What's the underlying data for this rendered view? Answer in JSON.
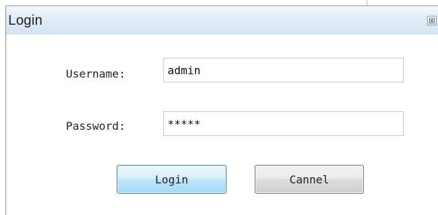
{
  "window": {
    "title": "Login",
    "close_icon": "close-icon"
  },
  "form": {
    "username_label": "Username:",
    "username_value": "admin",
    "password_label": "Password:",
    "password_value": "*****"
  },
  "buttons": {
    "login_label": "Login",
    "cancel_label": "Cannel"
  },
  "colors": {
    "titlebar": "#dbe8f6",
    "login_border": "#3c7fb1",
    "button_border": "#707070"
  }
}
